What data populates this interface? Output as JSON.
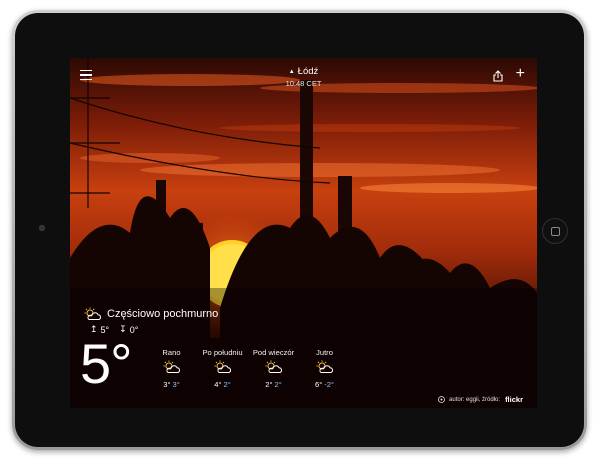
{
  "location": {
    "city": "Łódź",
    "time": "10:48 CET"
  },
  "current": {
    "condition": "Częściowo pochmurno",
    "icon": "partly-cloudy-icon",
    "high": "5°",
    "low": "0°",
    "temperature": "5°"
  },
  "forecast": [
    {
      "label": "Rano",
      "high": "3°",
      "low": "3°",
      "icon": "partly-cloudy-icon"
    },
    {
      "label": "Po południu",
      "high": "4°",
      "low": "2°",
      "icon": "partly-cloudy-icon"
    },
    {
      "label": "Pod wieczór",
      "high": "2°",
      "low": "2°",
      "icon": "partly-cloudy-icon"
    },
    {
      "label": "Jutro",
      "high": "6°",
      "low": "-2°",
      "icon": "partly-cloudy-icon"
    }
  ],
  "photo_credit": {
    "text": "autor: eggii, źródło:",
    "source": "flickr"
  },
  "colors": {
    "sky_top": "#3a0c05",
    "sky_mid": "#c23a10",
    "sun": "#ffcf2a",
    "low_temp": "#8fc5ff"
  }
}
